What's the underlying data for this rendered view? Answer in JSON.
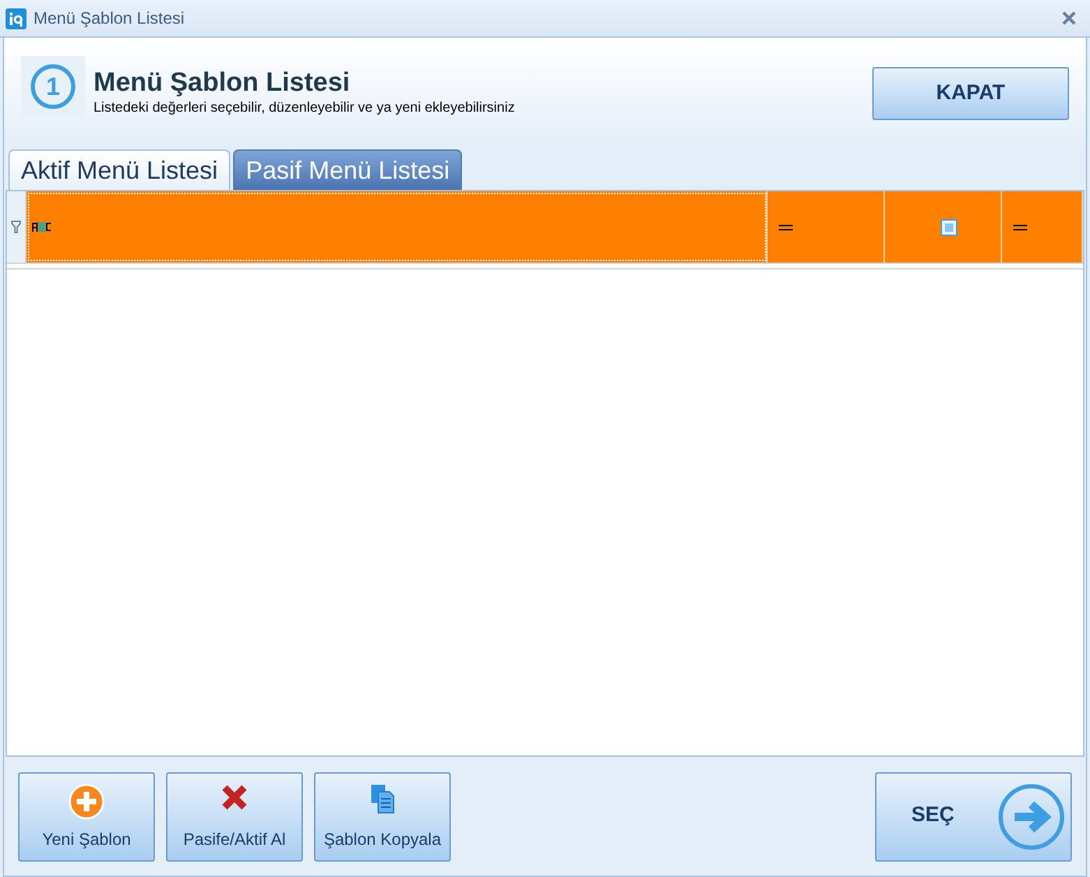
{
  "window": {
    "title": "Menü Şablon Listesi"
  },
  "header": {
    "step": "1",
    "title": "Menü Şablon Listesi",
    "subtitle": "Listedeki değerleri seçebilir, düzenleyebilir ve ya yeni ekleyebilirsiniz",
    "close_button": "KAPAT"
  },
  "tabs": [
    {
      "label": "Aktif Menü Listesi",
      "selected": false
    },
    {
      "label": "Pasif Menü Listesi",
      "selected": true
    }
  ],
  "filter_row": [
    {
      "kind": "text",
      "selected": true
    },
    {
      "kind": "equals",
      "selected": false
    },
    {
      "kind": "checkbox",
      "selected": false
    },
    {
      "kind": "equals",
      "selected": false
    }
  ],
  "buttons": [
    {
      "kind": "add",
      "label": "Yeni Şablon"
    },
    {
      "kind": "remove",
      "label": "Pasife/Aktif Al"
    },
    {
      "kind": "copy",
      "label": "Şablon Kopyala"
    }
  ],
  "select_button": "SEÇ"
}
